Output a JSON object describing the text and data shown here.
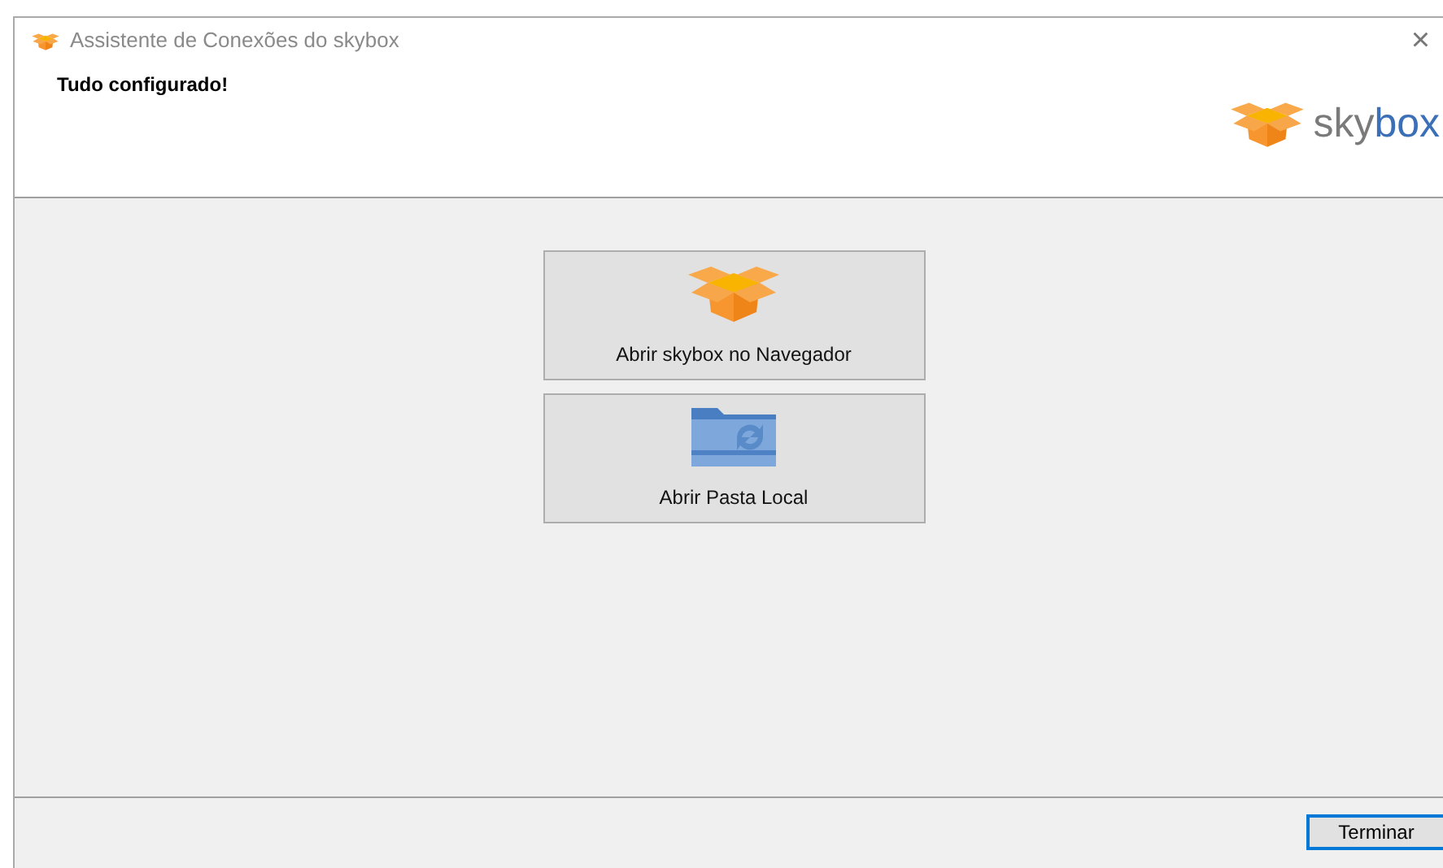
{
  "window": {
    "title": "Assistente de Conexões do skybox",
    "close": "×"
  },
  "header": {
    "heading": "Tudo configurado!",
    "logo": {
      "first": "sky",
      "second": "box"
    }
  },
  "actions": [
    {
      "kind": "box",
      "label": "Abrir skybox no Navegador"
    },
    {
      "kind": "folder",
      "label": "Abrir Pasta Local"
    }
  ],
  "footer": {
    "buttons": [
      {
        "label": "Terminar",
        "focused": true
      }
    ]
  }
}
